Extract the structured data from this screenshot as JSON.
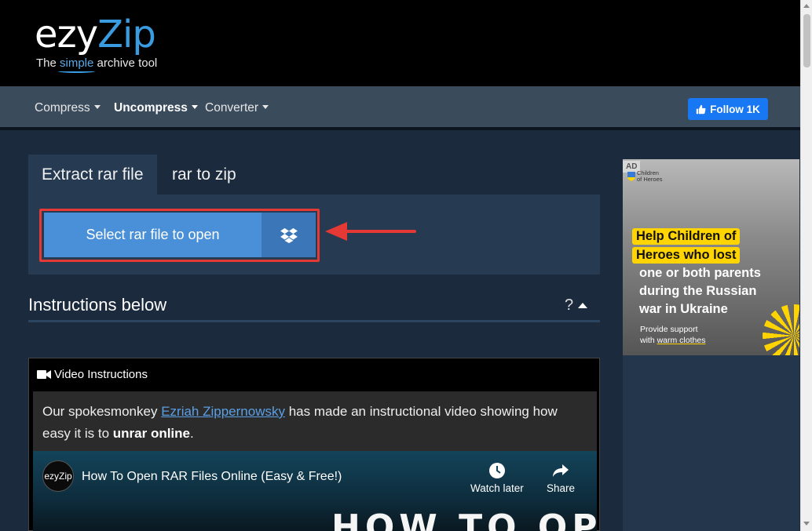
{
  "header": {
    "logo_ezy": "ezy",
    "logo_zip": "Zip",
    "tagline_pre": "The ",
    "tagline_simple": "simple",
    "tagline_post": " archive tool"
  },
  "nav": {
    "items": [
      {
        "label": "Compress",
        "active": false
      },
      {
        "label": "Uncompress",
        "active": true
      },
      {
        "label": "Converter",
        "active": false
      }
    ],
    "follow_label": "Follow 1K"
  },
  "tabs": [
    {
      "label": "Extract rar file",
      "active": true
    },
    {
      "label": "rar to zip",
      "active": false
    }
  ],
  "uploader": {
    "select_label": "Select rar file to open",
    "dropbox_icon": "dropbox-icon"
  },
  "instructions": {
    "title": "Instructions below",
    "help": "?"
  },
  "video_card": {
    "heading": "Video Instructions",
    "text_pre": "Our spokesmonkey ",
    "link": "Ezriah Zippernowsky",
    "text_mid": " has made an instructional video showing how easy it is to ",
    "text_bold": "unrar online",
    "text_post": "."
  },
  "youtube": {
    "channel": "ezyZip",
    "title": "How To Open RAR Files Online (Easy & Free!)",
    "watch_later": "Watch later",
    "share": "Share",
    "thumb_text": "HOW TO OPEN"
  },
  "ad": {
    "label": "AD",
    "org_line1": "Children",
    "org_line2": "of Heroes",
    "hl1": "Help Children of",
    "hl2": "Heroes who lost",
    "hl3": "one or both parents",
    "hl4": "during the Russian",
    "hl5": "war in Ukraine",
    "sub1": "Provide support",
    "sub2_pre": "with ",
    "sub2_link": "warm clothes"
  },
  "colors": {
    "accent": "#4a90d9",
    "brand_blue": "#3a9be0",
    "highlight": "#e53935",
    "ad_yellow": "#ffd400"
  }
}
